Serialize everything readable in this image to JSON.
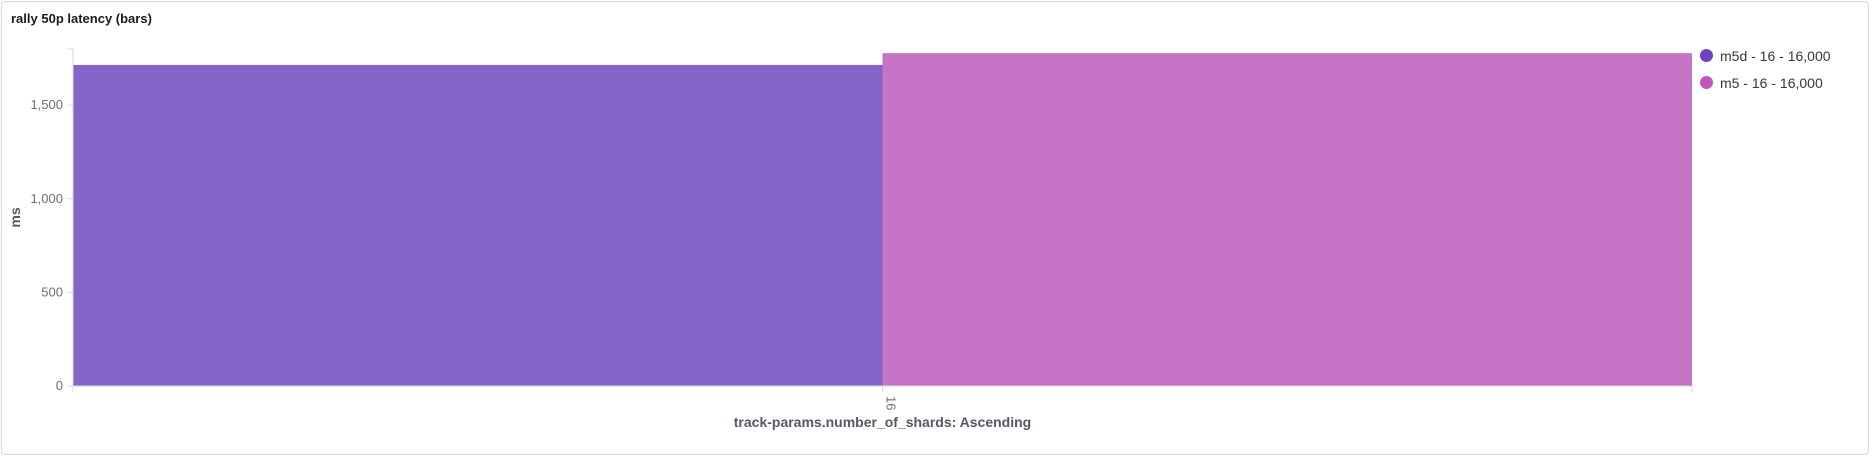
{
  "panel": {
    "title": "rally 50p latency (bars)"
  },
  "chart_data": {
    "type": "bar",
    "categories": [
      "16"
    ],
    "series": [
      {
        "name": "m5d - 16 - 16,000",
        "values": [
          1715
        ],
        "color": "#8464c6"
      },
      {
        "name": "m5 - 16 - 16,000",
        "values": [
          1778
        ],
        "color": "#c674c6"
      }
    ],
    "xlabel": "track-params.number_of_shards: Ascending",
    "ylabel": "ms",
    "ylim": [
      0,
      1800
    ],
    "yticks": [
      0,
      500,
      1000,
      1500
    ],
    "ytick_labels": [
      "0",
      "500",
      "1,000",
      "1,500"
    ],
    "legend_position": "right",
    "legend_dot_colors": [
      "#6f42c1",
      "#c054c0"
    ]
  }
}
